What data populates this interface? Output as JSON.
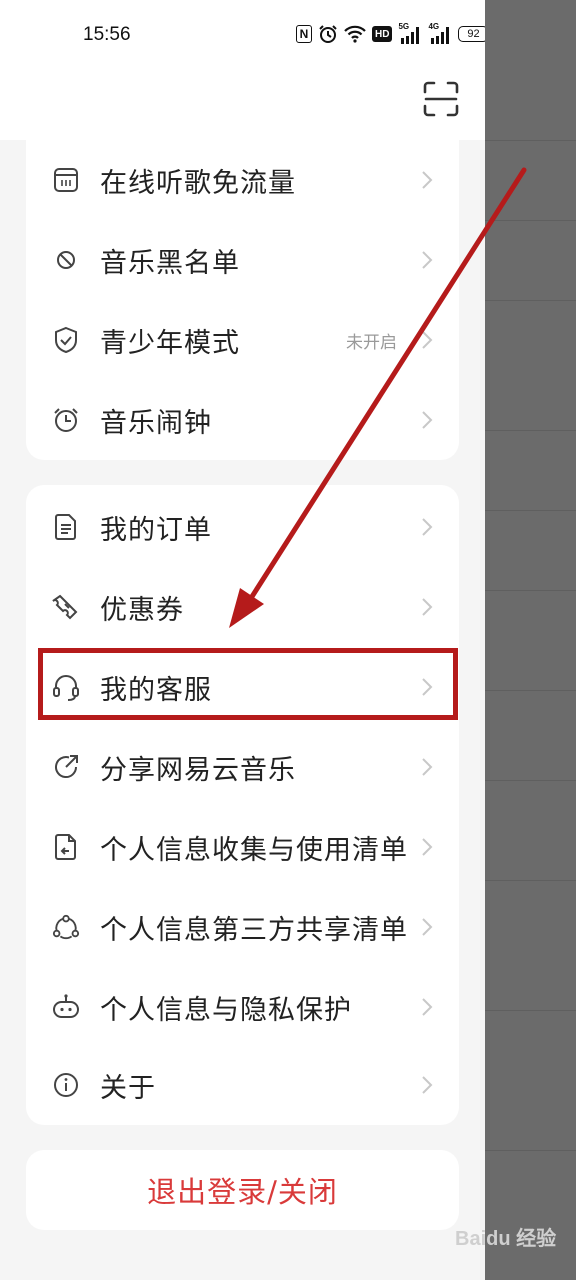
{
  "status_bar": {
    "time": "15:56",
    "nfc": "N",
    "hd": "HD",
    "net1": "5G",
    "net2": "4G",
    "battery": "92"
  },
  "group1": {
    "items": [
      {
        "label": "在线听歌免流量",
        "icon": "calendar-card-icon"
      },
      {
        "label": "音乐黑名单",
        "icon": "block-icon"
      },
      {
        "label": "青少年模式",
        "icon": "shield-check-icon",
        "status": "未开启"
      },
      {
        "label": "音乐闹钟",
        "icon": "alarm-clock-icon"
      }
    ]
  },
  "group2": {
    "items": [
      {
        "label": "我的订单",
        "icon": "order-document-icon"
      },
      {
        "label": "优惠券",
        "icon": "ticket-icon"
      },
      {
        "label": "我的客服",
        "icon": "headset-icon"
      },
      {
        "label": "分享网易云音乐",
        "icon": "share-icon"
      },
      {
        "label": "个人信息收集与使用清单",
        "icon": "file-return-icon"
      },
      {
        "label": "个人信息第三方共享清单",
        "icon": "share-nodes-icon"
      },
      {
        "label": "个人信息与隐私保护",
        "icon": "robot-privacy-icon"
      },
      {
        "label": "关于",
        "icon": "info-icon"
      }
    ]
  },
  "logout": {
    "label": "退出登录/关闭"
  },
  "watermark": "Baidu 经验",
  "colors": {
    "highlight": "#b51b1b",
    "logout_text": "#d93a3a"
  }
}
